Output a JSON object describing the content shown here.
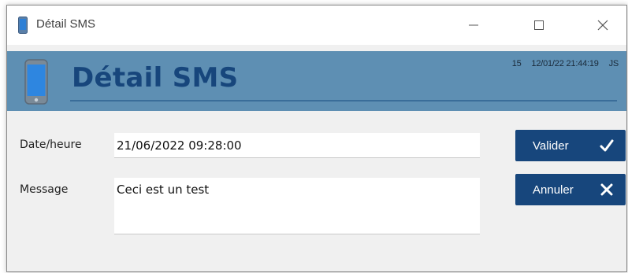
{
  "window": {
    "title": "Détail SMS",
    "icon": "phone-icon"
  },
  "banner": {
    "title": "Détail SMS",
    "icon": "phone-icon",
    "info": {
      "id": "15",
      "timestamp": "12/01/22 21:44:19",
      "user": "JS"
    }
  },
  "form": {
    "date_label": "Date/heure",
    "date_value": "21/06/2022 09:28:00",
    "message_label": "Message",
    "message_value": "Ceci est un test"
  },
  "buttons": {
    "validate_label": "Valider",
    "validate_icon": "checkmark-icon",
    "cancel_label": "Annuler",
    "cancel_icon": "close-x-icon"
  },
  "colors": {
    "banner_bg": "#5e8fb3",
    "title_text": "#17467c",
    "button_bg": "#17467c"
  }
}
